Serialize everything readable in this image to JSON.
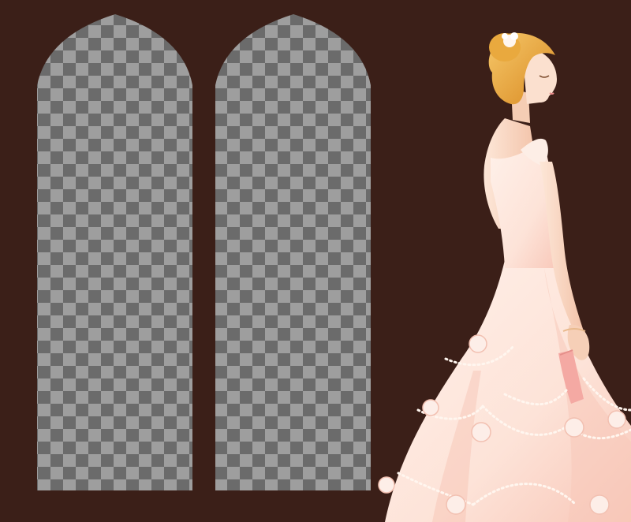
{
  "colors": {
    "background": "#3b1f18",
    "checker_light": "#9e9e9e",
    "checker_dark": "#6b6b6b",
    "dress": "#fde3d8",
    "dress_shadow": "#f6b8a8",
    "skin": "#fbe0cf",
    "hair": "#e6a536",
    "pearl": "#fff6ef",
    "clutch": "#f4a9a3"
  },
  "elements": {
    "photo_slot_left": "arched-photo-placeholder",
    "photo_slot_right": "arched-photo-placeholder",
    "figure": "bride-illustration"
  }
}
